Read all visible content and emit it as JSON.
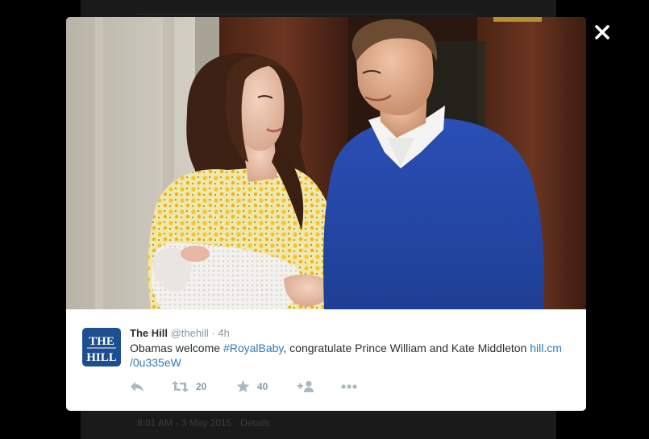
{
  "background_page": {
    "timestamp": "8:01 AM - 3 May 2015",
    "details_link": "Details"
  },
  "close": {
    "icon": "close-icon",
    "label": "Close"
  },
  "photo": {
    "alt": ""
  },
  "tweet": {
    "author": {
      "name": "The Hill",
      "handle": "@thehill",
      "avatar_text": "THE HILL"
    },
    "separator": "·",
    "time": "4h",
    "text": {
      "before": "Obamas welcome ",
      "hashtag": "#RoyalBaby",
      "middle": ", congratulate Prince William and Kate Middleton ",
      "link_line1": "hill.cm",
      "link_line2": "/0u335eW"
    },
    "actions": {
      "reply": {
        "icon": "reply-icon"
      },
      "retweet": {
        "icon": "retweet-icon",
        "count": "20"
      },
      "favorite": {
        "icon": "star-icon",
        "count": "40"
      },
      "follow": {
        "icon": "follow-user-icon"
      },
      "more": {
        "icon": "more-icon"
      }
    }
  },
  "colors": {
    "link": "#2b7bb9",
    "action_icon": "#aab8c2",
    "avatar_bg": "#1d4e8f",
    "overlay": "#000000"
  }
}
